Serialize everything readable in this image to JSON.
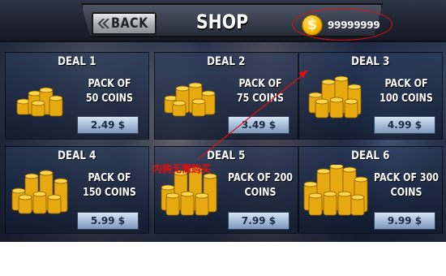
{
  "header": {
    "back_label": "BACK",
    "title": "SHOP",
    "coin_balance": "99999999",
    "coin_symbol": "$"
  },
  "deals": [
    {
      "title": "DEAL 1",
      "pack": "PACK OF\n50 COINS",
      "price": "2.49 $"
    },
    {
      "title": "DEAL 2",
      "pack": "PACK OF\n75 COINS",
      "price": "3.49 $"
    },
    {
      "title": "DEAL 3",
      "pack": "PACK OF\n100 COINS",
      "price": "4.99 $"
    },
    {
      "title": "DEAL 4",
      "pack": "PACK OF\n150 COINS",
      "price": "5.99 $"
    },
    {
      "title": "DEAL 5",
      "pack": "PACK OF 200\nCOINS",
      "price": "7.99 $"
    },
    {
      "title": "DEAL 6",
      "pack": "PACK OF 300\nCOINS",
      "price": "9.99 $"
    }
  ],
  "annotation": {
    "text": "内购无需购买",
    "color": "#e01010"
  },
  "colors": {
    "coin_gold": "#f5b800",
    "annotation_red": "#e01010"
  }
}
